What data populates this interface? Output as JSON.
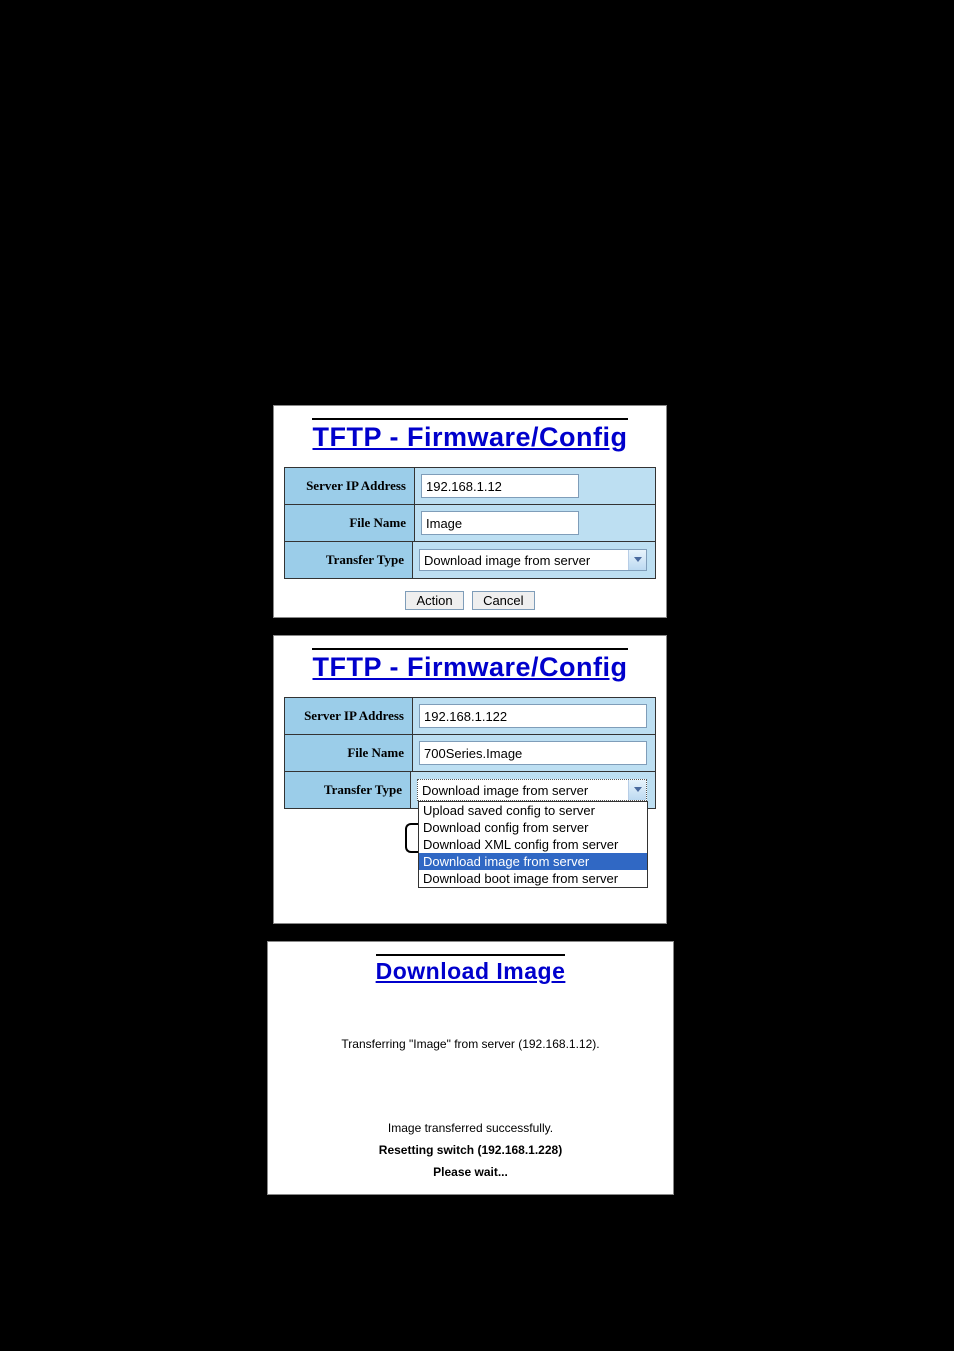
{
  "panel1": {
    "title": "TFTP - Firmware/Config",
    "rows": {
      "server_ip": {
        "label": "Server IP Address",
        "value": "192.168.1.12"
      },
      "file_name": {
        "label": "File Name",
        "value": "Image"
      },
      "transfer_type": {
        "label": "Transfer Type",
        "selected": "Download image from server"
      }
    },
    "buttons": {
      "action": "Action",
      "cancel": "Cancel"
    }
  },
  "panel2": {
    "title": "TFTP - Firmware/Config",
    "rows": {
      "server_ip": {
        "label": "Server IP Address",
        "value": "192.168.1.122"
      },
      "file_name": {
        "label": "File Name",
        "value": "700Series.Image"
      },
      "transfer_type": {
        "label": "Transfer Type",
        "selected": "Download image from server",
        "options": [
          "Upload saved config to server",
          "Download config from server",
          "Download XML config from server",
          "Download image from server",
          "Download boot image from server"
        ],
        "highlighted_index": 3
      }
    }
  },
  "panel3": {
    "title": "Download Image",
    "status": {
      "transferring": "Transferring \"Image\" from server (192.168.1.12).",
      "success": "Image transferred successfully.",
      "resetting": "Resetting switch (192.168.1.228)",
      "wait": "Please wait..."
    }
  }
}
